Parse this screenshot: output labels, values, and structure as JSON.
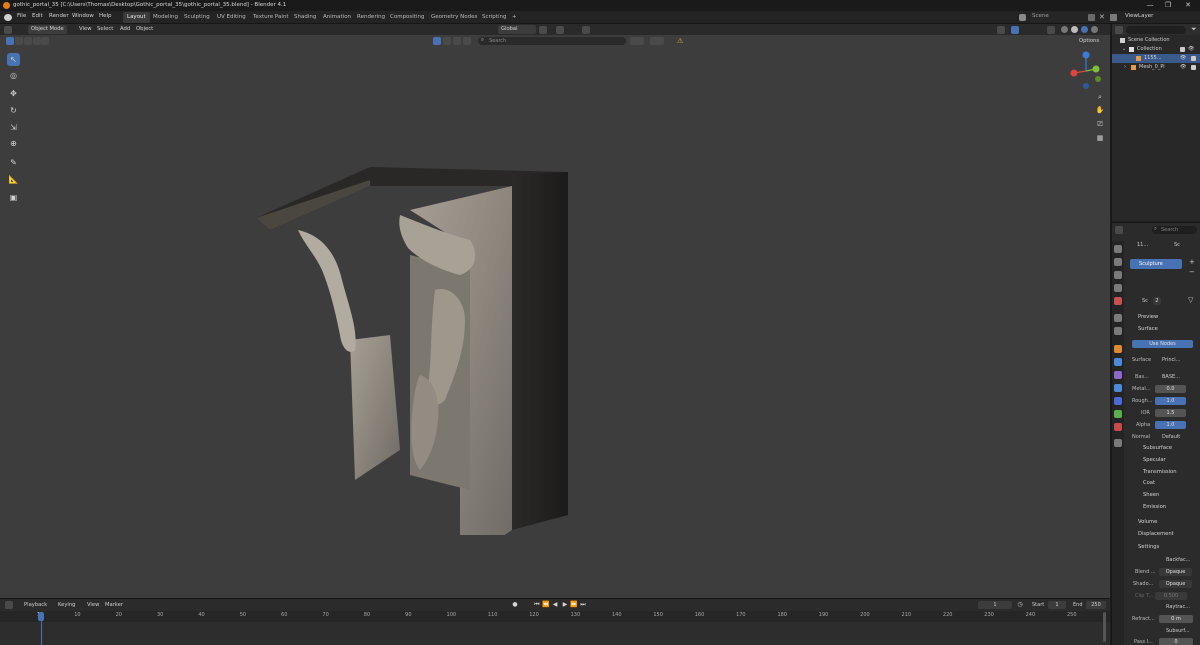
{
  "window": {
    "title": "gothic_portal_35 [C:\\Users\\Thomas\\Desktop\\Gothic_portal_35\\gothic_portal_35.blend] - Blender 4.1",
    "minimize": "—",
    "maximize": "❐",
    "close": "✕"
  },
  "menu": [
    "File",
    "Edit",
    "Render",
    "Window",
    "Help"
  ],
  "workspaces": [
    "Layout",
    "Modeling",
    "Sculpting",
    "UV Editing",
    "Texture Paint",
    "Shading",
    "Animation",
    "Rendering",
    "Compositing",
    "Geometry Nodes",
    "Scripting"
  ],
  "workspace_add": "+",
  "scene": {
    "label": "Scene",
    "viewlayer": "ViewLayer"
  },
  "viewport_header": {
    "mode": "Object Mode",
    "menus": [
      "View",
      "Select",
      "Add",
      "Object"
    ],
    "orientation": "Global",
    "search_placeholder": "Search",
    "options": "Options"
  },
  "outliner": {
    "search_placeholder": "",
    "rows": [
      {
        "label": "Scene Collection"
      },
      {
        "label": "Collection"
      },
      {
        "label": "1155..."
      },
      {
        "label": "Mesh_0_Pi"
      }
    ]
  },
  "properties": {
    "search_placeholder": "Search",
    "breadcrumb_obj": "11...",
    "breadcrumb_mat": "Sc",
    "material_slot": "Sculpture",
    "material_name": "Sc",
    "material_users": "2",
    "sections": {
      "preview": "Preview",
      "surface": "Surface",
      "use_nodes": "Use Nodes",
      "surface_label": "Surface",
      "surface_value": "Princi...",
      "base_label": "Bas...",
      "base_value": "BASE...",
      "metal_label": "Metal...",
      "metal_value": "0.0",
      "rough_label": "Rough...",
      "rough_value": "1.0",
      "ior_label": "IOR",
      "ior_value": "1.5",
      "alpha_label": "Alpha",
      "alpha_value": "1.0",
      "normal_label": "Normal",
      "normal_value": "Default",
      "subsurface": "Subsurface",
      "specular": "Specular",
      "transmission": "Transmission",
      "coat": "Coat",
      "sheen": "Sheen",
      "emission": "Emission",
      "volume": "Volume",
      "displacement": "Displacement",
      "settings": "Settings",
      "backface": "Backfac...",
      "blend_label": "Blend ...",
      "blend_value": "Opaque",
      "shadow_label": "Shado...",
      "shadow_value": "Opaque",
      "clip_label": "Clip T...",
      "clip_value": "0.500",
      "raytrace": "Raytrac...",
      "refract_label": "Refract...",
      "refract_value": "0 m",
      "subsurf": "Subsurf...",
      "pass_label": "Pass I...",
      "pass_value": "0"
    }
  },
  "timeline": {
    "menus": [
      "Playback",
      "Keying",
      "View",
      "Marker"
    ],
    "current_frame": "1",
    "start_label": "Start",
    "start_value": "1",
    "end_label": "End",
    "end_value": "250",
    "ticks": [
      "1",
      "10",
      "20",
      "30",
      "40",
      "50",
      "60",
      "70",
      "80",
      "90",
      "100",
      "110",
      "120",
      "130",
      "140",
      "150",
      "160",
      "170",
      "180",
      "190",
      "200",
      "210",
      "220",
      "230",
      "240",
      "250"
    ]
  },
  "gizmo": {
    "x": "X",
    "y": "Y",
    "z": "Z"
  },
  "colors": {
    "accent": "#4772b3",
    "x_axis": "#e0443f",
    "y_axis": "#7bbf3a",
    "z_axis": "#3a7be0"
  }
}
